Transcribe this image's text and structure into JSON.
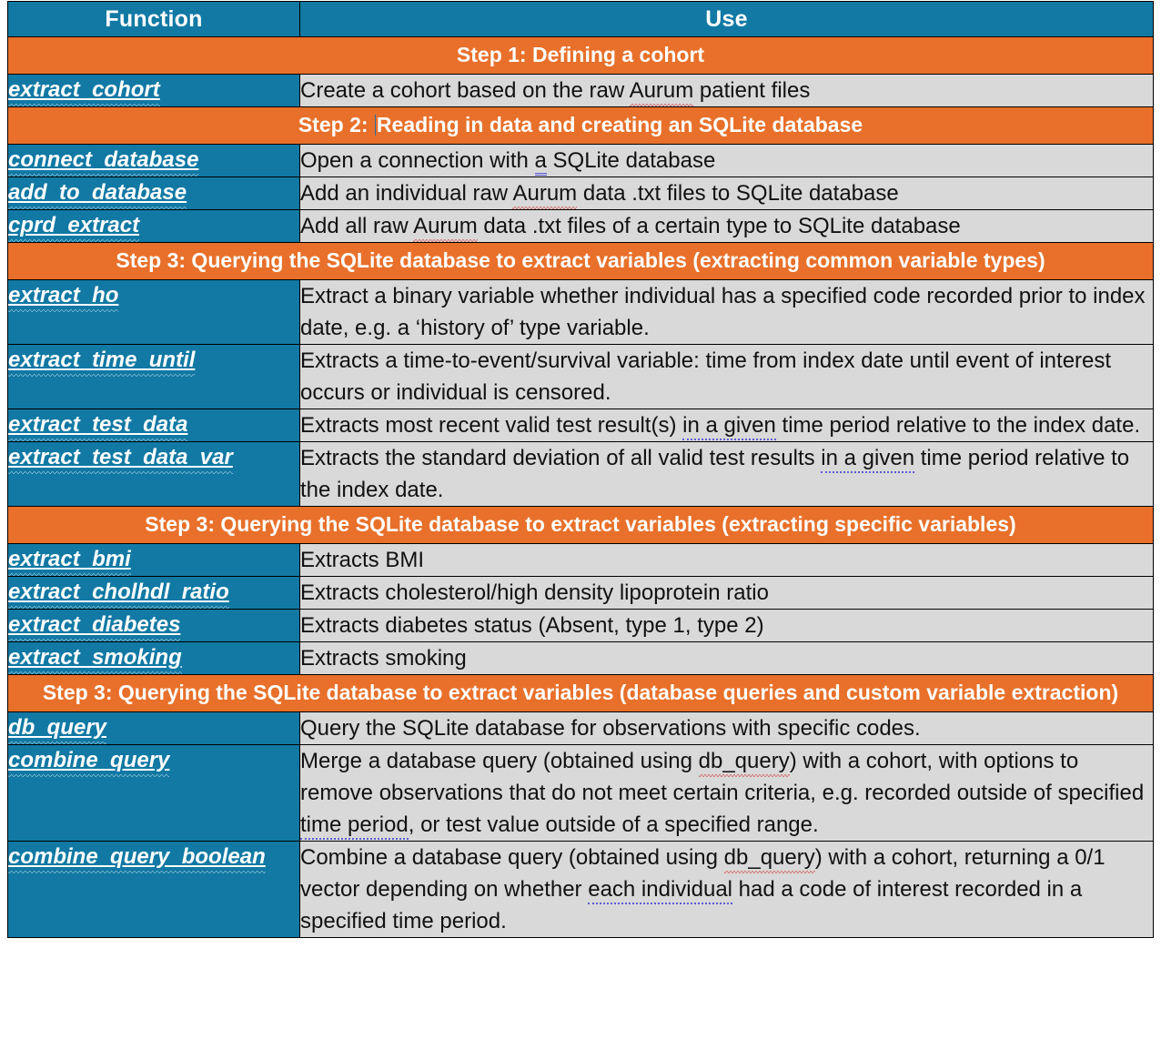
{
  "colors": {
    "header_blue": "#1179a4",
    "section_orange": "#e8702a",
    "cell_gray": "#d9d9d9",
    "text_white": "#ffffff",
    "text_black": "#111111",
    "spellcheck_red": "#d21e1e",
    "grammar_blue": "#5b5bd6"
  },
  "table": {
    "columns": {
      "function": "Function",
      "use": "Use"
    },
    "rows": [
      {
        "kind": "section",
        "label": "Step 1: Defining a cohort",
        "prefix": "Step 1: ",
        "body": "Defining a cohort",
        "cursor": false
      },
      {
        "kind": "entry",
        "function": "extract_cohort",
        "use": "Create a cohort based on the raw Aurum patient files",
        "use_parts": [
          {
            "text": "Create a cohort based on the raw ",
            "mark": "none"
          },
          {
            "text": "Aurum",
            "mark": "spell"
          },
          {
            "text": " patient files",
            "mark": "none"
          }
        ]
      },
      {
        "kind": "section",
        "label": "Step 2: Reading in data and creating an SQLite database",
        "prefix": "Step 2: ",
        "body": "Reading in data and creating an SQLite database",
        "cursor": true
      },
      {
        "kind": "entry",
        "function": "connect_database",
        "use": "Open a connection with a SQLite database",
        "use_parts": [
          {
            "text": "Open a connection with ",
            "mark": "none"
          },
          {
            "text": "a",
            "mark": "grammar-double"
          },
          {
            "text": " SQLite database",
            "mark": "none"
          }
        ]
      },
      {
        "kind": "entry",
        "function": "add_to_database",
        "use": "Add an individual raw Aurum data .txt files to SQLite database",
        "use_parts": [
          {
            "text": "Add an individual raw ",
            "mark": "none"
          },
          {
            "text": "Aurum",
            "mark": "spell"
          },
          {
            "text": " data .txt files to SQLite database",
            "mark": "none"
          }
        ]
      },
      {
        "kind": "entry",
        "function": "cprd_extract",
        "use": "Add all raw Aurum data .txt files of a certain type to SQLite database",
        "use_parts": [
          {
            "text": "Add all raw ",
            "mark": "none"
          },
          {
            "text": "Aurum",
            "mark": "spell"
          },
          {
            "text": " data .txt files of a certain type to SQLite database",
            "mark": "none"
          }
        ]
      },
      {
        "kind": "section",
        "label": "Step 3: Querying the SQLite database to extract variables (extracting common variable types)",
        "prefix": "",
        "body": "Step 3: Querying the SQLite database to extract variables (extracting common variable types)",
        "cursor": false
      },
      {
        "kind": "entry",
        "function": "extract_ho",
        "use": "Extract a binary variable whether individual has a specified code recorded prior to index date, e.g. a ‘history of’ type variable.",
        "use_parts": [
          {
            "text": "Extract a binary variable whether individual has a specified code recorded prior to index date, e.g. a ‘history of’ type variable.",
            "mark": "none"
          }
        ]
      },
      {
        "kind": "entry",
        "function": "extract_time_until",
        "use": "Extracts a time-to-event/survival variable: time from index date until event of interest occurs or individual is censored.",
        "use_parts": [
          {
            "text": "Extracts a time-to-event/survival variable: time from index date until event of interest occurs or individual is censored.",
            "mark": "none"
          }
        ]
      },
      {
        "kind": "entry",
        "function": "extract_test_data",
        "use": "Extracts most recent valid test result(s) in a given time period relative to the index date.",
        "use_parts": [
          {
            "text": "Extracts most recent valid test result(s) ",
            "mark": "none"
          },
          {
            "text": "in a given",
            "mark": "grammar"
          },
          {
            "text": " time period relative to the index date.",
            "mark": "none"
          }
        ]
      },
      {
        "kind": "entry",
        "function": "extract_test_data_var",
        "use": "Extracts the standard deviation of all valid test results in a given time period relative to the index date.",
        "use_parts": [
          {
            "text": "Extracts the standard deviation of all valid test results ",
            "mark": "none"
          },
          {
            "text": "in a given",
            "mark": "grammar"
          },
          {
            "text": " time period relative to the index date.",
            "mark": "none"
          }
        ]
      },
      {
        "kind": "section",
        "label": "Step 3: Querying the SQLite database to extract variables (extracting specific variables)",
        "prefix": "",
        "body": "Step 3: Querying the SQLite database to extract variables (extracting specific variables)",
        "cursor": false
      },
      {
        "kind": "entry",
        "function": "extract_bmi",
        "use": "Extracts BMI",
        "use_parts": [
          {
            "text": "Extracts BMI",
            "mark": "none"
          }
        ]
      },
      {
        "kind": "entry",
        "function": "extract_cholhdl_ratio",
        "use": "Extracts cholesterol/high density lipoprotein ratio",
        "use_parts": [
          {
            "text": "Extracts cholesterol/high density lipoprotein ratio",
            "mark": "none"
          }
        ]
      },
      {
        "kind": "entry",
        "function": "extract_diabetes",
        "use": "Extracts diabetes status (Absent, type 1, type 2)",
        "use_parts": [
          {
            "text": "Extracts diabetes status (Absent, type 1, type 2)",
            "mark": "none"
          }
        ]
      },
      {
        "kind": "entry",
        "function": "extract_smoking",
        "use": "Extracts smoking",
        "use_parts": [
          {
            "text": "Extracts smoking",
            "mark": "none"
          }
        ]
      },
      {
        "kind": "section",
        "label": "Step 3: Querying the SQLite database to extract variables (database queries and custom variable extraction)",
        "prefix": "",
        "body": "Step 3: Querying the SQLite database to extract variables (database queries and custom variable extraction)",
        "cursor": false
      },
      {
        "kind": "entry",
        "function": "db_query",
        "use": "Query the SQLite database for observations with specific codes.",
        "use_parts": [
          {
            "text": "Query the SQLite database for observations with specific codes.",
            "mark": "none"
          }
        ]
      },
      {
        "kind": "entry",
        "function": "combine_query",
        "use": "Merge a database query (obtained using db_query) with a cohort, with options to remove observations that do not meet certain criteria, e.g. recorded outside of specified time period, or test value outside of a specified range.",
        "use_parts": [
          {
            "text": "Merge a database query (obtained using ",
            "mark": "none"
          },
          {
            "text": "db_query",
            "mark": "spell"
          },
          {
            "text": ") with a cohort, with options to remove observations that do not meet certain criteria, e.g. recorded outside of specified ",
            "mark": "none"
          },
          {
            "text": "time period",
            "mark": "grammar"
          },
          {
            "text": ", or test value outside of a specified range.",
            "mark": "none"
          }
        ]
      },
      {
        "kind": "entry",
        "function": "combine_query_boolean",
        "use": "Combine a database query (obtained using db_query) with a cohort, returning a 0/1 vector depending on whether each individual had a code of interest recorded in a specified time period.",
        "use_parts": [
          {
            "text": "Combine a database query (obtained using ",
            "mark": "none"
          },
          {
            "text": "db_query",
            "mark": "spell"
          },
          {
            "text": ") with a cohort, returning a 0/1 vector depending on whether ",
            "mark": "none"
          },
          {
            "text": "each individual",
            "mark": "grammar"
          },
          {
            "text": " had a code of interest recorded in a specified time period.",
            "mark": "none"
          }
        ]
      }
    ]
  }
}
